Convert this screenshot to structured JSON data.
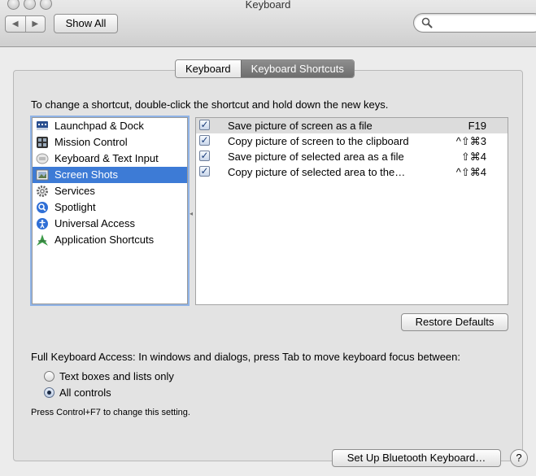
{
  "window": {
    "title": "Keyboard"
  },
  "toolbar": {
    "back_glyph": "◀",
    "forward_glyph": "▶",
    "show_all_label": "Show All",
    "search_placeholder": ""
  },
  "tabs": [
    {
      "label": "Keyboard",
      "selected": false
    },
    {
      "label": "Keyboard Shortcuts",
      "selected": true
    }
  ],
  "instruction": "To change a shortcut, double-click the shortcut and hold down the new keys.",
  "categories": [
    {
      "label": "Launchpad & Dock",
      "icon": "launchpad-icon",
      "selected": false
    },
    {
      "label": "Mission Control",
      "icon": "mission-control-icon",
      "selected": false
    },
    {
      "label": "Keyboard & Text Input",
      "icon": "keyboard-text-input-icon",
      "selected": false
    },
    {
      "label": "Screen Shots",
      "icon": "screen-shots-icon",
      "selected": true
    },
    {
      "label": "Services",
      "icon": "gear-icon",
      "selected": false
    },
    {
      "label": "Spotlight",
      "icon": "spotlight-icon",
      "selected": false
    },
    {
      "label": "Universal Access",
      "icon": "universal-access-icon",
      "selected": false
    },
    {
      "label": "Application Shortcuts",
      "icon": "application-shortcuts-icon",
      "selected": false
    }
  ],
  "shortcuts": [
    {
      "label": "Save picture of screen as a file",
      "key": "F19",
      "checked": true,
      "selected": true
    },
    {
      "label": "Copy picture of screen to the clipboard",
      "key": "^⇧⌘3",
      "checked": true,
      "selected": false
    },
    {
      "label": "Save picture of selected area as a file",
      "key": "⇧⌘4",
      "checked": true,
      "selected": false
    },
    {
      "label": "Copy picture of selected area to the…",
      "key": "^⇧⌘4",
      "checked": true,
      "selected": false
    }
  ],
  "restore_defaults_label": "Restore Defaults",
  "full_keyboard_access": {
    "label": "Full Keyboard Access: In windows and dialogs, press Tab to move keyboard focus between:",
    "options": [
      {
        "label": "Text boxes and lists only",
        "selected": false
      },
      {
        "label": "All controls",
        "selected": true
      }
    ],
    "hint": "Press Control+F7 to change this setting."
  },
  "bluetooth_button_label": "Set Up Bluetooth Keyboard…",
  "help_label": "?",
  "colors": {
    "selection_blue": "#3d7bd6",
    "checkbox_check": "#1a3d7a"
  }
}
